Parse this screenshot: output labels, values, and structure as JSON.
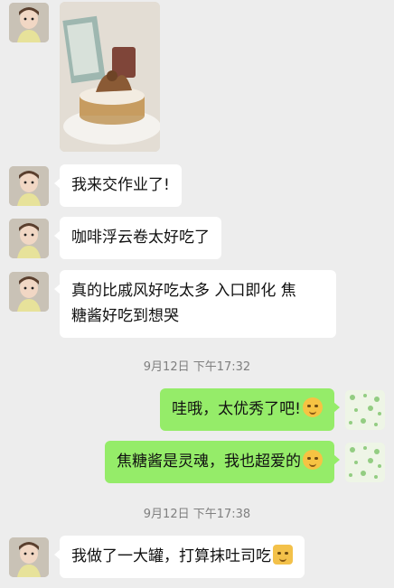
{
  "chat": {
    "timestamps": [
      "9月12日 下午17:32",
      "9月12日 下午17:38"
    ],
    "messages": [
      {
        "side": "in",
        "type": "image"
      },
      {
        "side": "in",
        "text": "我来交作业了!"
      },
      {
        "side": "in",
        "text": "咖啡浮云卷太好吃了"
      },
      {
        "side": "in",
        "text_line1": "真的比戚风好吃太多 入口即化 焦",
        "text_line2": "糖酱好吃到想哭"
      },
      {
        "side": "out",
        "text": "哇哦，太优秀了吧!",
        "emoji": "smirk-emoji"
      },
      {
        "side": "out",
        "text": "焦糖酱是灵魂，我也超爱的",
        "emoji": "blush-emoji"
      },
      {
        "side": "in",
        "text": "我做了一大罐，打算抹吐司吃",
        "emoji": "cat-emoji"
      }
    ]
  },
  "colors": {
    "background": "#ededed",
    "incoming_bubble": "#ffffff",
    "outgoing_bubble": "#95ec69",
    "timestamp_text": "#7f7f7f"
  }
}
